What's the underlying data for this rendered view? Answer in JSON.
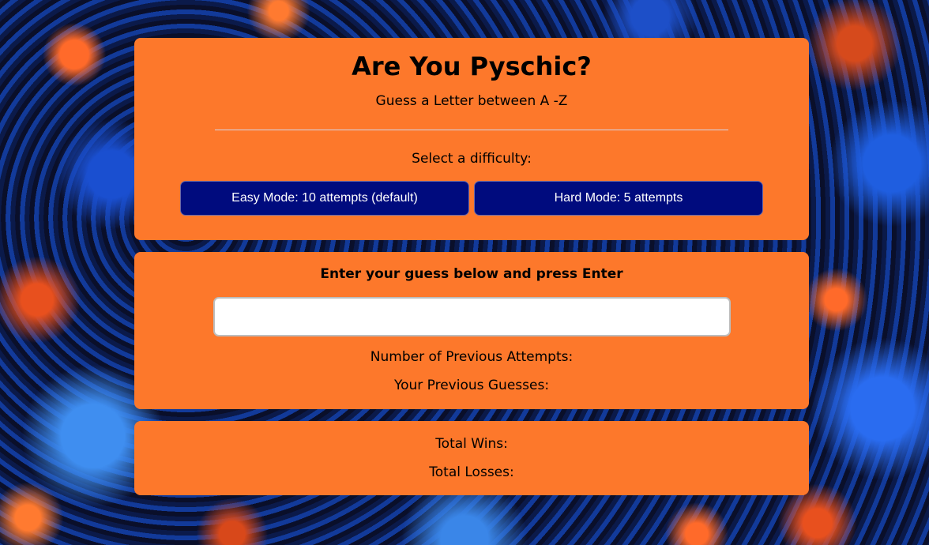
{
  "header": {
    "title": "Are You Pyschic?",
    "subtitle": "Guess a Letter between A -Z"
  },
  "difficulty": {
    "label": "Select a difficulty:",
    "easy_label": "Easy Mode: 10 attempts (default)",
    "hard_label": "Hard Mode: 5 attempts"
  },
  "guess": {
    "label": "Enter your guess below and press Enter",
    "value": "",
    "placeholder": "",
    "attempts_label": "Number of Previous Attempts:",
    "previous_label": "Your Previous Guesses:"
  },
  "stats": {
    "wins_label": "Total Wins:",
    "losses_label": "Total Losses:"
  },
  "colors": {
    "panel": "#fd782b",
    "button": "#000b7e",
    "button_text": "#ffffff"
  }
}
